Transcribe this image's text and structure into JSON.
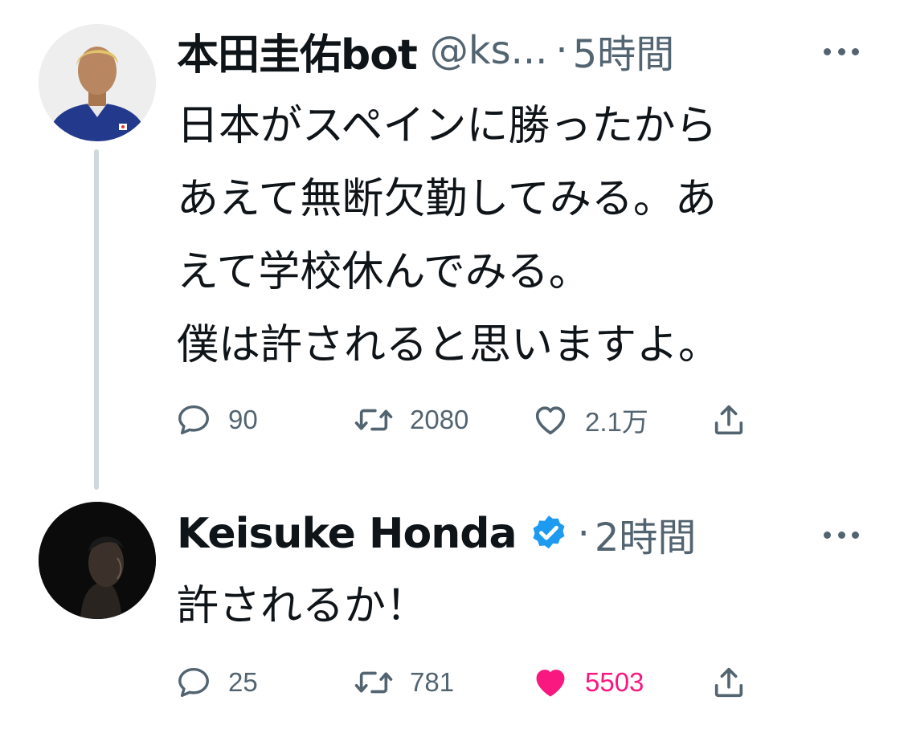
{
  "tweets": [
    {
      "display_name": "本田圭佑bot",
      "handle": "@ks...",
      "separator": "·",
      "time": "5時間",
      "verified": false,
      "text": "日本がスペインに勝ったから\nあえて無断欠勤してみる。あ\nえて学校休んでみる。\n僕は許されると思いますよ。",
      "stats": {
        "replies": "90",
        "retweets": "2080",
        "likes": "2.1万",
        "liked": false
      },
      "avatar_icon": "avatar-photo-player-in-japan-jersey"
    },
    {
      "display_name": "Keisuke Honda",
      "separator": "·",
      "time": "2時間",
      "verified": true,
      "text": "許されるか！",
      "stats": {
        "replies": "25",
        "retweets": "781",
        "likes": "5503",
        "liked": true
      },
      "avatar_icon": "avatar-photo-dark-portrait"
    }
  ],
  "colors": {
    "text_primary": "#0f1419",
    "text_secondary": "#536471",
    "thread_line": "#cfd9de",
    "verified_blue": "#1d9bf0",
    "like_pink": "#f91880"
  },
  "icons": [
    "reply-icon",
    "retweet-icon",
    "like-icon",
    "share-icon",
    "more-icon",
    "verified-badge-icon"
  ]
}
